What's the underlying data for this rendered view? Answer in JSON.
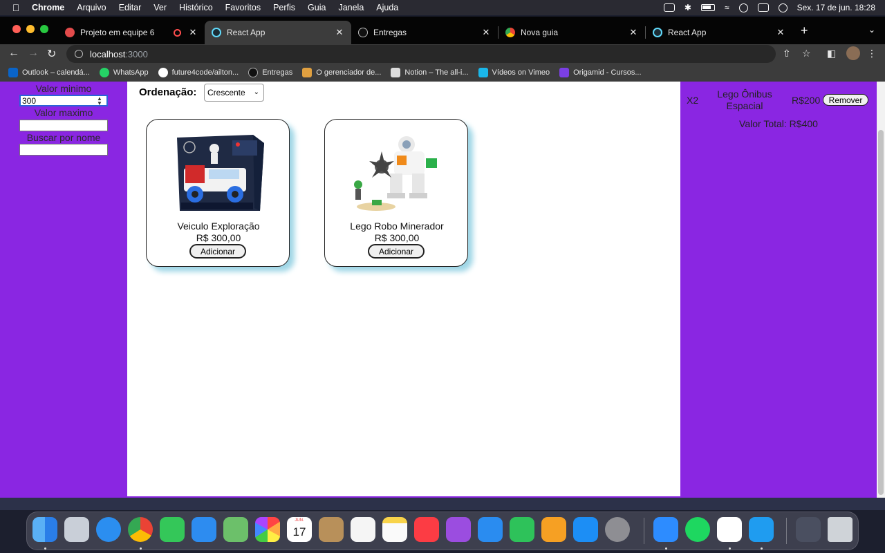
{
  "menubar": {
    "app": "Chrome",
    "items": [
      "Arquivo",
      "Editar",
      "Ver",
      "Histórico",
      "Favoritos",
      "Perfis",
      "Guia",
      "Janela",
      "Ajuda"
    ],
    "datetime": "Sex. 17 de jun.  18:28"
  },
  "tabs": [
    {
      "label": "Projeto em equipe 6",
      "icon": "project-icon",
      "recording": true
    },
    {
      "label": "React App",
      "icon": "react-icon",
      "active": true
    },
    {
      "label": "Entregas",
      "icon": "github-icon"
    },
    {
      "label": "Nova guia",
      "icon": "chrome-icon"
    },
    {
      "label": "React App",
      "icon": "react-icon"
    }
  ],
  "address": {
    "host": "localhost",
    "port": ":3000"
  },
  "bookmarks": [
    {
      "label": "Outlook – calendá...",
      "color": "#0a64c8"
    },
    {
      "label": "WhatsApp",
      "color": "#25d366"
    },
    {
      "label": "future4code/ailton...",
      "color": "#ffffff"
    },
    {
      "label": "Entregas",
      "color": "#111111"
    },
    {
      "label": "O gerenciador de...",
      "color": "#e0a040"
    },
    {
      "label": "Notion – The all-i...",
      "color": "#dddddd"
    },
    {
      "label": "Vídeos on Vimeo",
      "color": "#1ab7ea"
    },
    {
      "label": "Origamid - Cursos...",
      "color": "#7b3fe4"
    }
  ],
  "filters": {
    "min_label": "Valor minimo",
    "min_value": "300",
    "max_label": "Valor maximo",
    "max_value": "",
    "name_label": "Buscar por nome",
    "name_value": ""
  },
  "sort": {
    "label": "Ordenação:",
    "selected": "Crescente"
  },
  "products": [
    {
      "name": "Veiculo Exploração",
      "price": "R$ 300,00",
      "button": "Adicionar"
    },
    {
      "name": "Lego Robo Minerador",
      "price": "R$ 300,00",
      "button": "Adicionar"
    }
  ],
  "cart": {
    "items": [
      {
        "qty": "X2",
        "name": "Lego Ônibus Espacial",
        "price": "R$200",
        "button": "Remover"
      }
    ],
    "total": "Valor Total: R$400"
  },
  "dock": {
    "calendar_month": "JUN.",
    "calendar_day": "17"
  },
  "colors": {
    "sidebar_bg": "#8a26e2",
    "card_shadow": "#9ed6e6"
  }
}
